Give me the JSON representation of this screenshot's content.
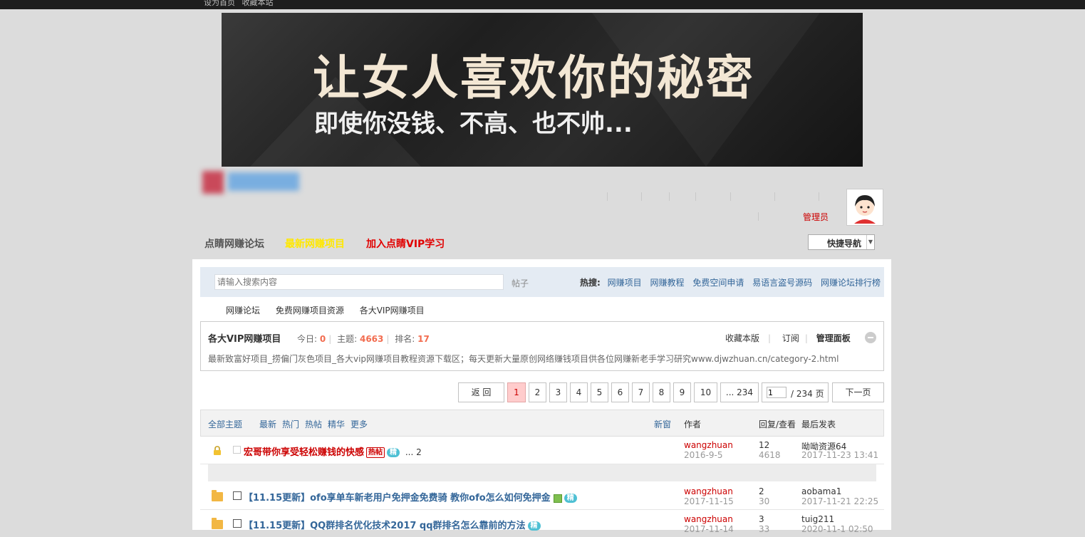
{
  "topbar": {
    "links": [
      "设为首页",
      "收藏本站"
    ]
  },
  "banner": {
    "title": "让女人喜欢你的秘密",
    "subtitle": "即使你没钱、不高、也不帅..."
  },
  "user": {
    "role": "管理员"
  },
  "nav": {
    "home": "点睛网赚论坛",
    "item2": "最新网赚项目",
    "vip": "加入点睛VIP学习",
    "quicknav": "快捷导航"
  },
  "search": {
    "placeholder": "请输入搜索内容",
    "type": "帖子",
    "hot_label": "热搜:",
    "hot": [
      "网赚项目",
      "网赚教程",
      "免费空间申请",
      "易语言盗号源码",
      "网赚论坛排行榜"
    ]
  },
  "breadcrumb": [
    "网赚论坛",
    "免费网赚项目资源",
    "各大VIP网赚项目"
  ],
  "forum": {
    "name": "各大VIP网赚项目",
    "today_label": "今日:",
    "today": "0",
    "topics_label": "主题:",
    "topics": "4663",
    "rank_label": "排名:",
    "rank": "17",
    "actions": {
      "favorite": "收藏本版",
      "subscribe": "订阅",
      "admin": "管理面板"
    },
    "description": "最新致富好项目_捞偏门灰色项目_各大vip网赚项目教程资源下载区；每天更新大量原创网络赚钱项目供各位网赚新老手学习研究www.djwzhuan.cn/category-2.html"
  },
  "pagination": {
    "back": "返 回",
    "pages": [
      "1",
      "2",
      "3",
      "4",
      "5",
      "6",
      "7",
      "8",
      "9",
      "10"
    ],
    "last": "... 234",
    "input_value": "1",
    "total": "/ 234 页",
    "next": "下一页"
  },
  "list_header": {
    "all": "全部主题",
    "latest": "最新",
    "hot": "热门",
    "hotpost": "热帖",
    "digest": "精华",
    "more": "更多",
    "new_window": "新窗",
    "author": "作者",
    "reply_view": "回复/查看",
    "last_post": "最后发表"
  },
  "threads": [
    {
      "title": "宏哥带你享受轻松赚钱的快感",
      "badge_hot": "热帖",
      "badge_digest": "精",
      "pages": "... 2",
      "author": "wangzhuan",
      "date": "2016-9-5",
      "replies": "12",
      "views": "4618",
      "last_user": "呦呦资源64",
      "last_time": "2017-11-23 13:41"
    },
    {
      "title": "【11.15更新】ofo享单车新老用户免押金免费骑 教你ofo怎么如何免押金",
      "badge_digest": "精",
      "author": "wangzhuan",
      "date": "2017-11-15",
      "replies": "2",
      "views": "30",
      "last_user": "aobama1",
      "last_time": "2017-11-21 22:25"
    },
    {
      "title": "【11.15更新】QQ群排名优化技术2017 qq群排名怎么靠前的方法",
      "badge_digest": "精",
      "author": "wangzhuan",
      "date": "2017-11-14",
      "replies": "3",
      "views": "33",
      "last_user": "tuig211",
      "last_time": "2020-11-1 02:50"
    }
  ]
}
